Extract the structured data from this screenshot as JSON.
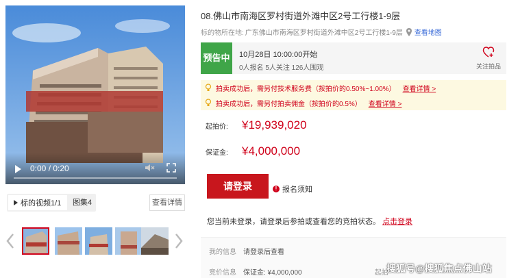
{
  "colors": {
    "accent": "#c8161d",
    "status_green": "#3fa548",
    "link_blue": "#3a6bd8",
    "notice_bg": "#fdf9e1"
  },
  "video": {
    "time": "0:00 / 0:20",
    "icons": {
      "play": "play-icon",
      "mute": "mute-icon",
      "fullscreen": "fullscreen-icon"
    },
    "progress": 0
  },
  "media_tabs": {
    "video_tab": "标的视频1/1",
    "album_tab": "图集4",
    "detail_button": "查看详情"
  },
  "thumbnails": {
    "count": 5,
    "active_index": 0
  },
  "header": {
    "title": "08.佛山市南海区罗村街道外滩中区2号工行楼1-9层",
    "location_label": "标的物所在地:",
    "location_value": "广东佛山市南海区罗村街道外滩中区2号工行楼1-9层",
    "map_link": "查看地图"
  },
  "status": {
    "badge": "预告中",
    "start_time": "10月28日 10:00:00开始",
    "stats": "0人报名  5人关注  126人围观",
    "follow_label": "关注拍品"
  },
  "notices": [
    {
      "text": "拍卖成功后，需另付技术服务费（按拍价的0.50%~1.00%）",
      "link": "查看详情 >"
    },
    {
      "text": "拍卖成功后，需另付拍卖佣金（按拍价的0.5%）",
      "link": "查看详情 >"
    }
  ],
  "prices": {
    "start_label": "起拍价:",
    "start_value": "¥19,939,020",
    "deposit_label": "保证金:",
    "deposit_value": "¥4,000,000"
  },
  "actions": {
    "login_button": "请登录",
    "registration_notice": "报名须知"
  },
  "login_prompt": {
    "text": "您当前未登录，请登录后参拍或查看您的竞拍状态。",
    "link": "点击登录"
  },
  "bid_info": {
    "my_info_label": "我的信息",
    "my_info_value": "请登录后查看",
    "bid_info_label": "竞价信息",
    "bid_info_value": "保证金: ¥4,000,000",
    "bid_info_cut": "起拍"
  },
  "watermark": "搜狐号@搜狐焦点佛山站"
}
